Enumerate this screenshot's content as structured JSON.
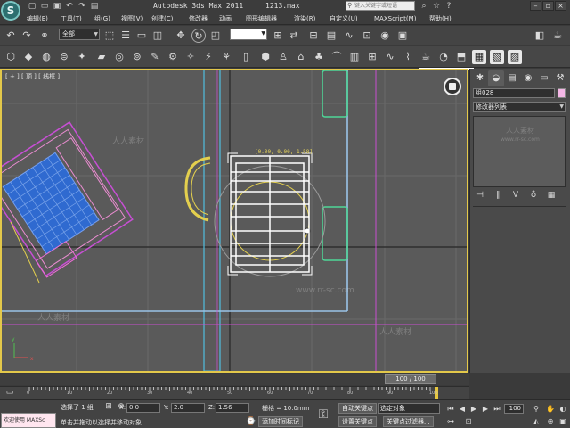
{
  "titlebar": {
    "app_title": "Autodesk 3ds Max  2011",
    "file_name": "1213.max",
    "search_placeholder": "键入关键字或短语",
    "menu": [
      "编辑(E)",
      "工具(T)",
      "组(G)",
      "视图(V)",
      "创建(C)",
      "修改器",
      "动画",
      "图形编辑器",
      "渲染(R)",
      "自定义(U)",
      "MAXScript(M)",
      "帮助(H)"
    ]
  },
  "toolbar": {
    "selection_filter": "全部",
    "icons": [
      "undo-icon",
      "redo-icon",
      "link-icon",
      "unlink-icon",
      "bind-spacewarp-icon",
      "select-icon",
      "select-by-name-icon",
      "rect-region-icon",
      "window-crossing-icon",
      "move-icon",
      "rotate-icon",
      "scale-icon",
      "ref-coord-icon",
      "pivot-icon",
      "mirror-icon",
      "align-icon",
      "layer-icon",
      "curve-editor-icon",
      "schematic-icon",
      "material-editor-icon",
      "render-setup-icon",
      "render-icon"
    ]
  },
  "viewport": {
    "label": "[ + ] [ 顶 ] [ 线框 ]",
    "coord_readout": "[0.00, 0.00, 1.58]",
    "watermarks": [
      "人人素材",
      "www.rr-sc.com"
    ]
  },
  "command_panel": {
    "tabs": [
      "create-tab-icon",
      "modify-tab-icon",
      "hierarchy-tab-icon",
      "motion-tab-icon",
      "display-tab-icon",
      "utilities-tab-icon"
    ],
    "object_name": "组028",
    "object_color": "#f4b7e6",
    "modifier_list": "修改器列表",
    "stack_tools": [
      "pin-stack-icon",
      "show-end-result-icon",
      "make-unique-icon",
      "remove-modifier-icon",
      "configure-modifier-sets-icon"
    ]
  },
  "timeline": {
    "frame_display": "100 / 100",
    "tick_labels": [
      "0",
      "10",
      "20",
      "30",
      "40",
      "50",
      "60",
      "70",
      "80",
      "90",
      "100"
    ]
  },
  "status": {
    "maxscript": "欢迎使用 MAXSc",
    "selection": "选择了 1 组",
    "prompt": "单击并拖动以选择并移动对象",
    "x_label": "X:",
    "x_value": "0.0",
    "y_label": "Y:",
    "y_value": "2.0",
    "z_label": "Z:",
    "z_value": "1.56",
    "grid": "栅格 = 10.0mm",
    "add_time_tag": "添加时间标记",
    "auto_key": "自动关键点",
    "selected_dd": "选定对象",
    "set_key": "设置关键点",
    "key_filters": "关键点过滤器...",
    "current_frame": "100"
  }
}
